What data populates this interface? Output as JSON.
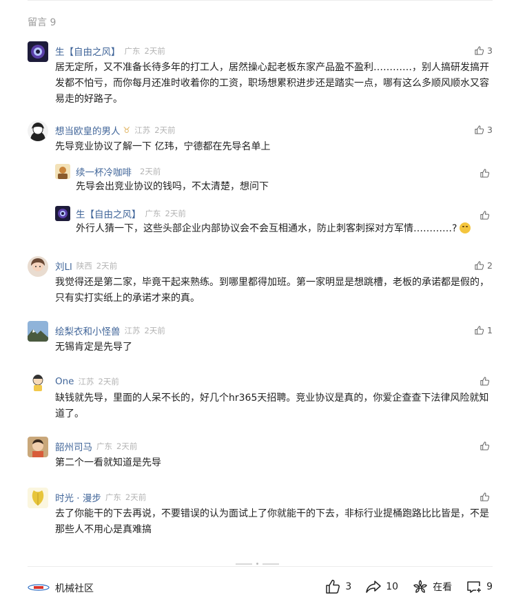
{
  "section": {
    "title": "留言 9"
  },
  "comments": [
    {
      "user": "生【自由之风】",
      "location": "广东",
      "time": "2天前",
      "likes": "3",
      "text": "居无定所，又不准备长待多年的打工人，居然操心起老板东家产品盈不盈利…………，别人搞研发搞开发都不怕亏，而你每月还准时收着你的工资，职场想累积进步还是踏实一点，哪有这么多顺风顺水又容易走的好路子。"
    },
    {
      "user": "想当欧皇的男人",
      "badge": "♉",
      "location": "江苏",
      "time": "2天前",
      "likes": "3",
      "text": "先导竞业协议了解一下 亿玮，宁德都在先导名单上"
    },
    {
      "user": "续一杯冷咖啡",
      "location": "",
      "time": "2天前",
      "likes": "",
      "text": "先导会出竞业协议的钱吗，不太清楚，想问下"
    },
    {
      "user": "生【自由之风】",
      "location": "广东",
      "time": "2天前",
      "likes": "",
      "text": "外行人猜一下，这些头部企业内部协议会不会互相通水，防止刺客刺探对方军情…………?"
    },
    {
      "user": "刘Ll",
      "location": "陕西",
      "time": "2天前",
      "likes": "2",
      "text": "我觉得还是第二家，毕竟干起来熟练。到哪里都得加班。第一家明显是想跳槽，老板的承诺都是假的，只有实打实纸上的承诺才来的真。"
    },
    {
      "user": "绘梨衣和小怪兽",
      "location": "江苏",
      "time": "2天前",
      "likes": "1",
      "text": "无锡肯定是先导了"
    },
    {
      "user": "One",
      "location": "江苏",
      "time": "2天前",
      "likes": "",
      "text": "缺钱就先导，里面的人呆不长的，好几个hr365天招聘。竞业协议是真的，你爱企查查下法律风险就知道了。"
    },
    {
      "user": "韶州司马",
      "location": "广东",
      "time": "2天前",
      "likes": "",
      "text": "第二个一看就知道是先导"
    },
    {
      "user": "时光 · 漫步",
      "location": "广东",
      "time": "2天前",
      "likes": "",
      "text": "去了你能干的下去再说，不要错误的认为面试上了你就能干的下去，非标行业提桶跑路比比皆是，不是那些人不用心是真难搞"
    }
  ],
  "footer": {
    "brand": "机械社区",
    "like_count": "3",
    "share_count": "10",
    "watching_label": "在看",
    "comment_count": "9"
  },
  "icons": {
    "like": "thumbs-up-icon",
    "share": "share-arrow-icon",
    "watching": "flower-icon",
    "comment": "comment-bubble-plus-icon"
  },
  "colors": {
    "username": "#406599",
    "meta": "#b3b3b3",
    "text": "#222222"
  }
}
